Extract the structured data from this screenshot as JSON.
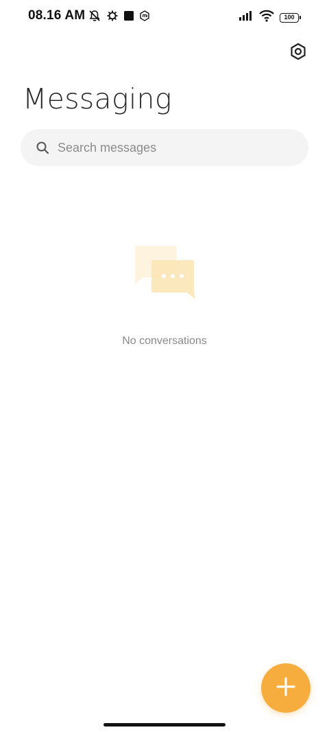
{
  "status_bar": {
    "time": "08.16 AM",
    "battery": "100",
    "icons_left": [
      "mute-notifications-icon",
      "debug-bug-icon",
      "square-app-icon",
      "mi-shield-icon"
    ],
    "icons_right": [
      "signal-icon",
      "wifi-icon",
      "battery-icon"
    ]
  },
  "header": {
    "title": "Messaging",
    "settings_icon": "gear-hexagon-icon"
  },
  "search": {
    "placeholder": "Search messages",
    "icon": "search-icon"
  },
  "empty_state": {
    "illustration": "chat-bubbles-icon",
    "message": "No conversations"
  },
  "fab": {
    "icon": "plus-icon",
    "color": "#f7ad3e"
  },
  "colors": {
    "accent": "#f7ad3e",
    "search_bg": "#f4f4f4",
    "muted_text": "#8a8a8a"
  }
}
